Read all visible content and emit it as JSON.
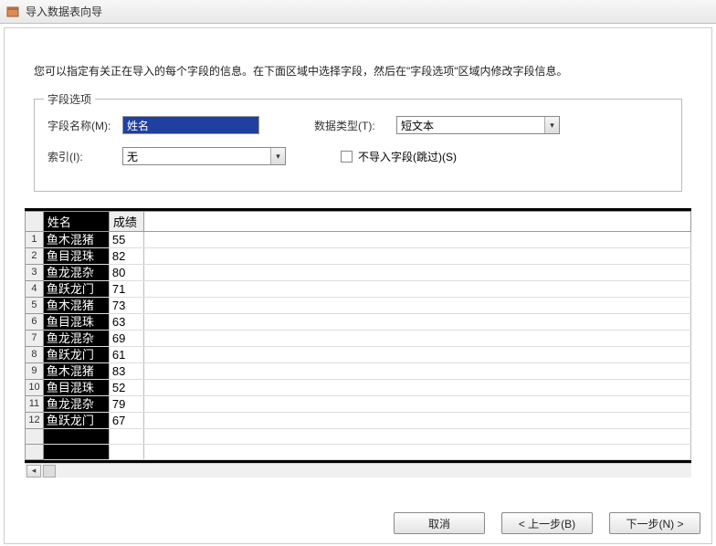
{
  "window": {
    "title": "导入数据表向导"
  },
  "instruction": "您可以指定有关正在导入的每个字段的信息。在下面区域中选择字段，然后在\"字段选项\"区域内修改字段信息。",
  "fieldOptions": {
    "legend": "字段选项",
    "fieldNameLabel": "字段名称(M):",
    "fieldNameValue": "姓名",
    "dataTypeLabel": "数据类型(T):",
    "dataTypeValue": "短文本",
    "indexLabel": "索引(I):",
    "indexValue": "无",
    "skipLabel": "不导入字段(跳过)(S)",
    "skipChecked": false
  },
  "grid": {
    "headers": {
      "name": "姓名",
      "score": "成绩"
    },
    "rows": [
      {
        "n": "1",
        "name": "鱼木混猪",
        "score": "55"
      },
      {
        "n": "2",
        "name": "鱼目混珠",
        "score": "82"
      },
      {
        "n": "3",
        "name": "鱼龙混杂",
        "score": "80"
      },
      {
        "n": "4",
        "name": "鱼跃龙门",
        "score": "71"
      },
      {
        "n": "5",
        "name": "鱼木混猪",
        "score": "73"
      },
      {
        "n": "6",
        "name": "鱼目混珠",
        "score": "63"
      },
      {
        "n": "7",
        "name": "鱼龙混杂",
        "score": "69"
      },
      {
        "n": "8",
        "name": "鱼跃龙门",
        "score": "61"
      },
      {
        "n": "9",
        "name": "鱼木混猪",
        "score": "83"
      },
      {
        "n": "10",
        "name": "鱼目混珠",
        "score": "52"
      },
      {
        "n": "11",
        "name": "鱼龙混杂",
        "score": "79"
      },
      {
        "n": "12",
        "name": "鱼跃龙门",
        "score": "67"
      }
    ]
  },
  "buttons": {
    "cancel": "取消",
    "back": "< 上一步(B)",
    "next": "下一步(N) >"
  }
}
